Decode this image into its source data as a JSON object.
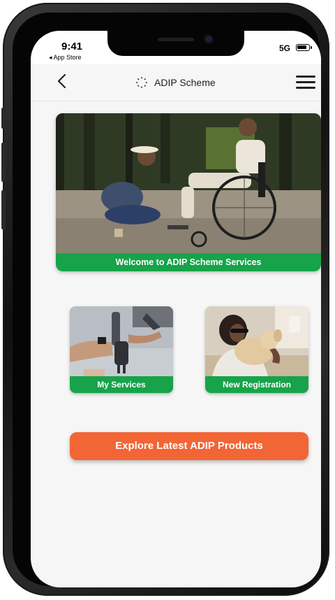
{
  "status_bar": {
    "time": "9:41",
    "back_app": "◂ App Store",
    "network": "5G",
    "battery_icon": "battery-full-icon"
  },
  "header": {
    "title": "ADIP Scheme",
    "back_icon": "chevron-left-icon",
    "logo_icon": "scheme-logo-icon",
    "menu_icon": "hamburger-menu-icon"
  },
  "hero": {
    "label": "Welcome to ADIP Scheme Services"
  },
  "tiles": [
    {
      "label": "My Services"
    },
    {
      "label": "New Registration"
    }
  ],
  "explore_button": {
    "label": "Explore Latest ADIP Products"
  },
  "colors": {
    "accent_green": "#16a34a",
    "accent_orange": "#f26535",
    "background": "#f6f6f6"
  }
}
